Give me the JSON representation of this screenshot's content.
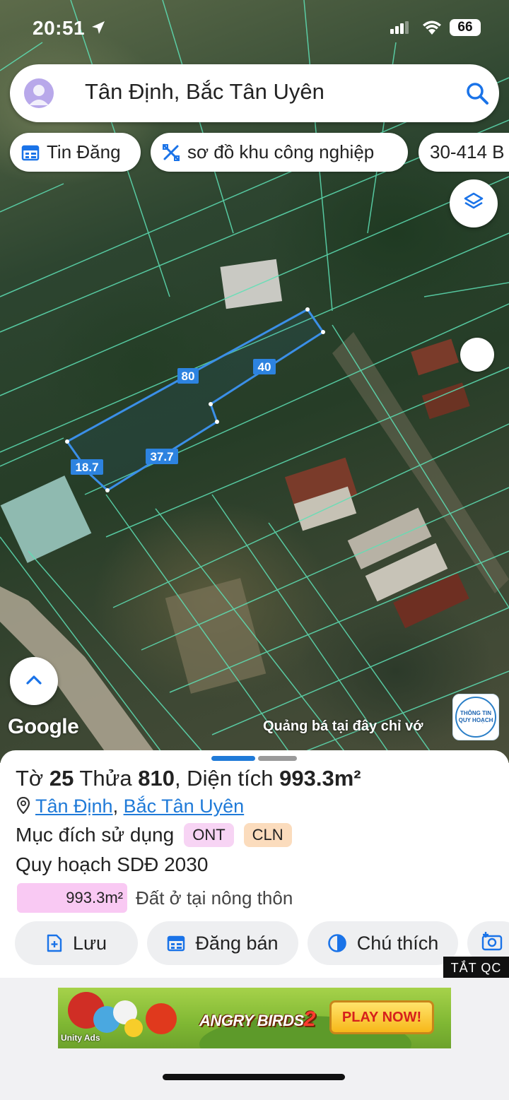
{
  "status_bar": {
    "time": "20:51",
    "battery": "66"
  },
  "search": {
    "query": "Tân Định, Bắc Tân Uyên"
  },
  "chips": [
    {
      "label": "Tin Đăng",
      "icon": "calendar-icon"
    },
    {
      "label": "sơ đồ khu công nghiệp",
      "icon": "tools-icon"
    },
    {
      "label": "30-414 B"
    }
  ],
  "map": {
    "parcel_edges": [
      "80",
      "40",
      "37.7",
      "18.7"
    ],
    "attribution": "Google",
    "promo_text": "Quảng bá tại đây chỉ vớ",
    "info_badge_line1": "THÔNG TIN",
    "info_badge_line2": "QUY HOẠCH"
  },
  "parcel": {
    "sheet_prefix": "Tờ ",
    "sheet_no": "25",
    "plot_prefix": " Thửa ",
    "plot_no": "810",
    "area_prefix": ", Diện tích ",
    "area": "993.3m²",
    "ward": "Tân Định",
    "separator": ", ",
    "district": "Bắc Tân Uyên",
    "purpose_label": "Mục đích sử dụng",
    "purpose_tags": [
      "ONT",
      "CLN"
    ],
    "plan_label": "Quy hoạch SDĐ 2030",
    "plan_area": "993.3m²",
    "plan_desc": "Đất ở tại nông thôn"
  },
  "actions": [
    {
      "label": "Lưu",
      "icon": "save-add-icon"
    },
    {
      "label": "Đăng bán",
      "icon": "calendar-icon"
    },
    {
      "label": "Chú thích",
      "icon": "contrast-icon"
    }
  ],
  "close_ad": "TẮT QC",
  "ad": {
    "logo_text": "ANGRY BIRDS",
    "logo_number": "2",
    "cta": "PLAY NOW!",
    "network": "Unity Ads"
  },
  "colors": {
    "accent_blue": "#1f7ad8",
    "parcel_line": "#3b8fe8",
    "grid_line": "#5ee0b5",
    "tag_ont_bg": "#f7d4f4",
    "tag_cln_bg": "#fbdcbd",
    "area_chip_bg": "#f9c9f3"
  }
}
